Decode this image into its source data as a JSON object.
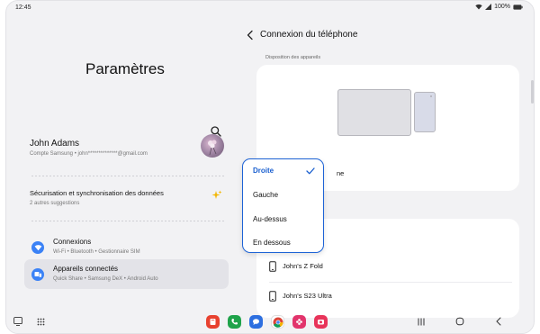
{
  "status_bar": {
    "time": "12:45",
    "battery": "100%"
  },
  "left_pane": {
    "title": "Paramètres",
    "profile": {
      "name": "John Adams",
      "subtitle": "Compte Samsung • john**************@gmail.com"
    },
    "suggestion": {
      "title": "Sécurisation et synchronisation des données",
      "subtitle": "2 autres suggestions"
    },
    "items": [
      {
        "title": "Connexions",
        "subtitle": "Wi-Fi • Bluetooth • Gestionnaire SIM",
        "icon": "wifi-icon",
        "color": "#3b82f6"
      },
      {
        "title": "Appareils connectés",
        "subtitle": "Quick Share • Samsung DeX • Android Auto",
        "icon": "connected-devices-icon",
        "color": "#3b82f6"
      }
    ]
  },
  "right_pane": {
    "title": "Connexion du téléphone",
    "section_label": "Disposition des appareils",
    "card_label_partial": "ne",
    "devices": [
      {
        "name": "John's Z Fold"
      },
      {
        "name": "John's S23 Ultra"
      }
    ]
  },
  "dropdown": {
    "options": [
      "Droite",
      "Gauche",
      "Au-dessus",
      "En dessous"
    ],
    "selected": "Droite",
    "accent": "#1d63d6"
  },
  "dock_apps": [
    {
      "icon": "notes-app-icon",
      "color": "#e8412f"
    },
    {
      "icon": "phone-app-icon",
      "color": "#1fa34a"
    },
    {
      "icon": "messages-app-icon",
      "color": "#2d6fe0"
    },
    {
      "icon": "chrome-app-icon",
      "color": "#e8e8e8"
    },
    {
      "icon": "gallery-app-icon",
      "color": "#e2346c"
    },
    {
      "icon": "camera-app-icon",
      "color": "#e8345a"
    }
  ]
}
